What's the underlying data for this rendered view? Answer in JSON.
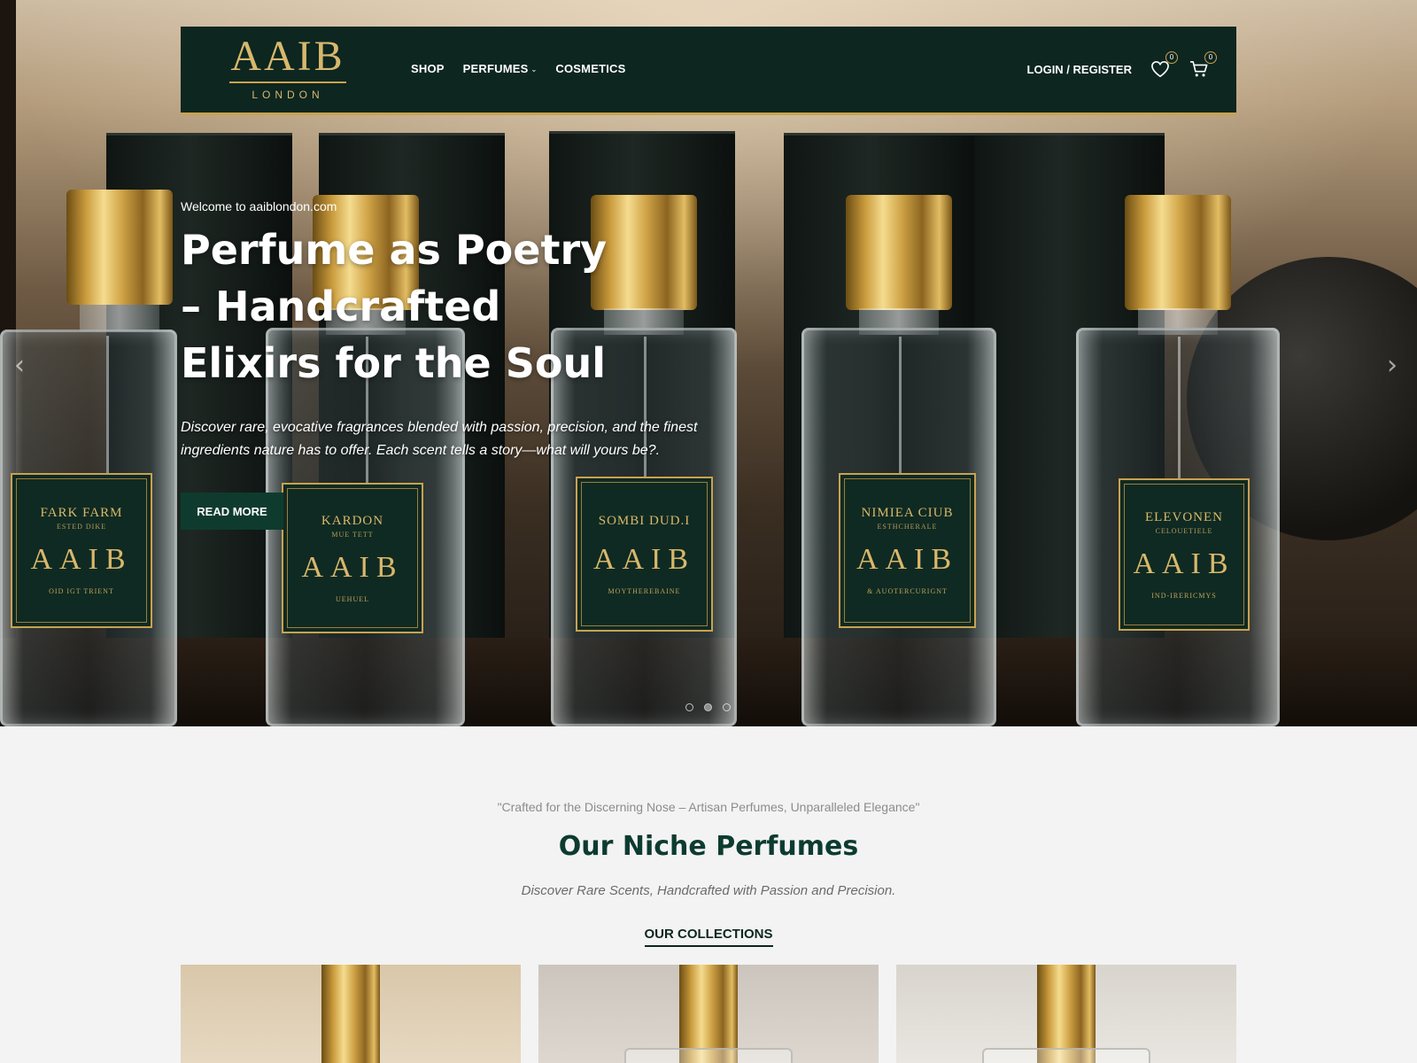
{
  "header": {
    "logo_main": "AAIB",
    "logo_sub": "LONDON",
    "nav": [
      {
        "label": "SHOP",
        "has_dropdown": false
      },
      {
        "label": "PERFUMES",
        "has_dropdown": true
      },
      {
        "label": "COSMETICS",
        "has_dropdown": false
      }
    ],
    "login_label": "LOGIN / REGISTER",
    "wishlist_count": "0",
    "cart_count": "0"
  },
  "hero": {
    "welcome": "Welcome to aaiblondon.com",
    "title": "Perfume as Poetry – Handcrafted Elixirs for the Soul",
    "description": "Discover rare, evocative fragrances blended with passion, precision, and the finest ingredients nature has to offer. Each scent tells a story—what will yours be?.",
    "button_label": "READ MORE",
    "slides_total": 3,
    "active_slide": 2,
    "bottles": [
      {
        "name": "FARK FARM",
        "small": "ESTED DIKE",
        "brand": "AAIB",
        "foot": "OID IGT TRIENT"
      },
      {
        "name": "KARDON",
        "small": "MUE TETT",
        "brand": "AAIB",
        "foot": "UEHUEL"
      },
      {
        "name": "SOMBI DUD.I",
        "small": "",
        "brand": "AAIB",
        "foot": "MOYTHEREBAINE"
      },
      {
        "name": "NIMIEA CIUB",
        "small": "ESTHCHERALE",
        "brand": "AAIB",
        "foot": "& AUOTERCURIGNT"
      },
      {
        "name": "ELEVONEN",
        "small": "CELOUETIELE",
        "brand": "AAIB",
        "foot": "IND-IRERICMYS"
      }
    ]
  },
  "section": {
    "quote": "\"Crafted for the Discerning Nose – Artisan Perfumes, Unparalleled Elegance\"",
    "title": "Our Niche Perfumes",
    "subtitle": "Discover Rare Scents, Handcrafted with Passion and Precision.",
    "collections_label": "OUR COLLECTIONS"
  },
  "colors": {
    "header_bg": "#0d2620",
    "gold": "#c9a24f",
    "button_bg": "#0f3b2e",
    "section_title": "#0d3b30"
  },
  "icons": [
    "heart-icon",
    "cart-icon",
    "chevron-left-icon",
    "chevron-right-icon",
    "chevron-down-icon"
  ]
}
